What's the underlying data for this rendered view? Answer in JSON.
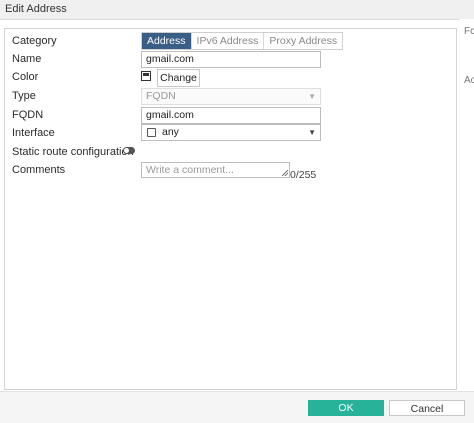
{
  "window": {
    "title": "Edit Address"
  },
  "form": {
    "category_label": "Category",
    "category_tabs": [
      "Address",
      "IPv6 Address",
      "Proxy Address"
    ],
    "name_label": "Name",
    "name_value": "gmail.com",
    "color_label": "Color",
    "color_button": "Change",
    "type_label": "Type",
    "type_value": "FQDN",
    "fqdn_label": "FQDN",
    "fqdn_value": "gmail.com",
    "interface_label": "Interface",
    "interface_value": "any",
    "static_route_label": "Static route configuration",
    "comments_label": "Comments",
    "comments_placeholder": "Write a comment...",
    "comments_counter": "0/255"
  },
  "footer": {
    "ok": "OK",
    "cancel": "Cancel"
  },
  "right_panel": {
    "text_1": "Fc",
    "text_2": "Ac"
  },
  "colors": {
    "accent": "#3a5f86",
    "ok_button": "#26b39a"
  }
}
